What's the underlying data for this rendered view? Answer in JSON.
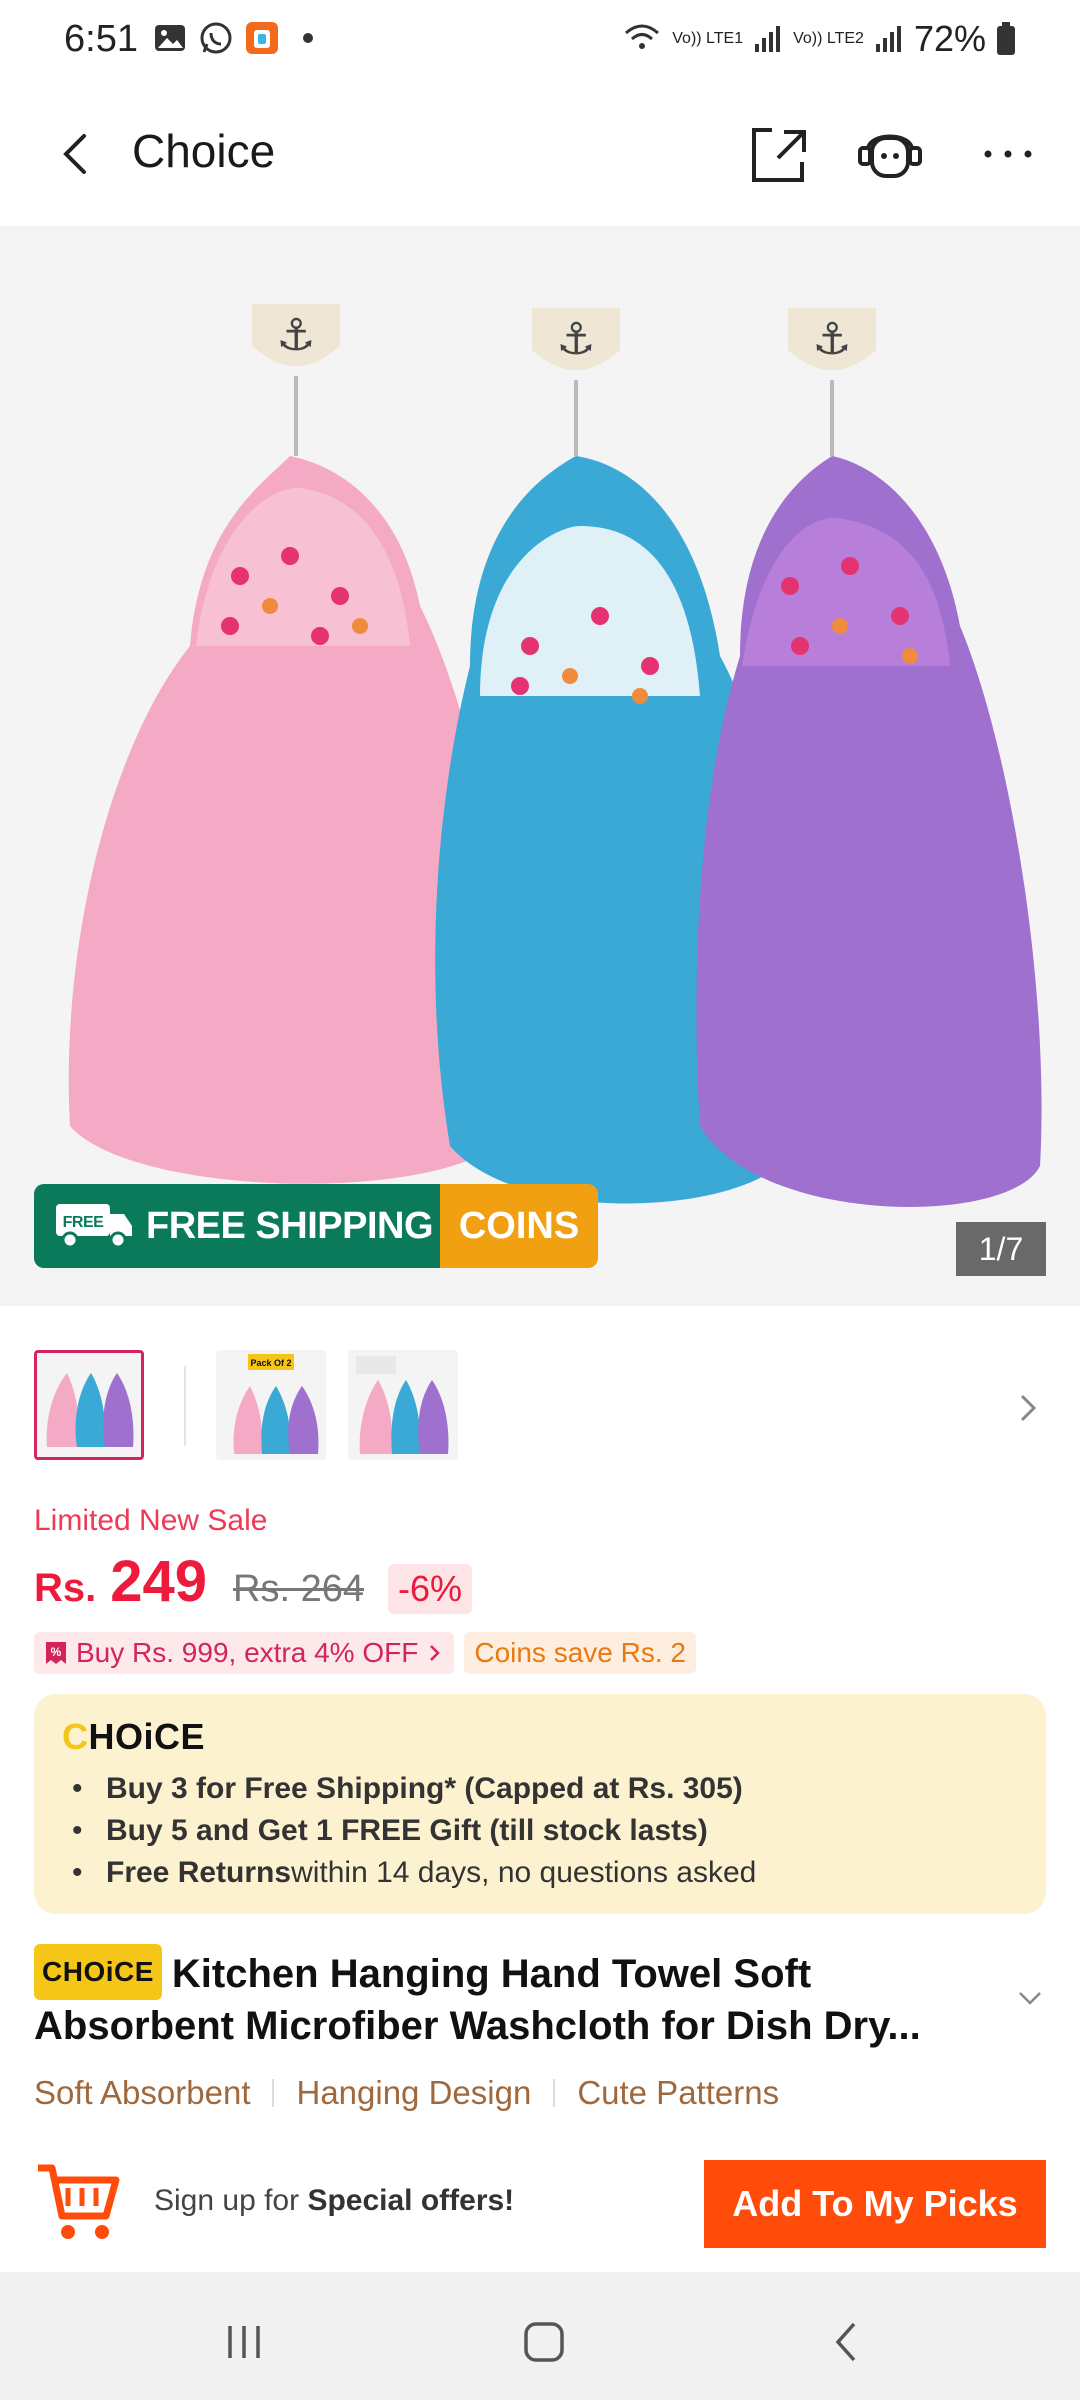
{
  "status_bar": {
    "time": "6:51",
    "battery": "72%",
    "net1": "Vo)) LTE1",
    "net2": "Vo)) LTE2"
  },
  "header": {
    "title": "Choice",
    "icons": [
      "back-icon",
      "share-icon",
      "support-icon",
      "more-icon"
    ]
  },
  "hero": {
    "free_shipping": "FREE SHIPPING",
    "free_tag": "FREE",
    "coins": "COINS",
    "counter": "1/7",
    "towel_colors": [
      "#f4a9c4",
      "#3aa9d6",
      "#a070cf"
    ]
  },
  "thumbnails": {
    "count": 3,
    "pack_badge": "Pack Of 2"
  },
  "price": {
    "label": "Limited New Sale",
    "currency": "Rs.",
    "current": "249",
    "original": "Rs. 264",
    "discount": "-6%"
  },
  "promos": {
    "buy_offer": "Buy Rs. 999, extra 4% OFF",
    "coins_save": "Coins save Rs. 2"
  },
  "choice": {
    "logo_c": "C",
    "logo_rest": "HOiCE",
    "items": [
      {
        "bold": "Buy 3 for  Free Shipping* (Capped at Rs. 305)",
        "rest": ""
      },
      {
        "bold": "Buy 5 and Get 1 FREE Gift (till stock lasts)",
        "rest": ""
      },
      {
        "bold": "Free Returns",
        "rest": " within 14 days, no questions asked"
      }
    ]
  },
  "product": {
    "badge": "CHOiCE",
    "title": "Kitchen Hanging Hand Towel Soft Absorbent Microfiber Washcloth for Dish Dry...",
    "features": [
      "Soft Absorbent",
      "Hanging Design",
      "Cute Patterns"
    ]
  },
  "bottom": {
    "signup_prefix": "Sign up for ",
    "signup_bold": "Special offers!",
    "picks_label": "Add To My Picks"
  },
  "colors": {
    "accent": "#ff4c0a",
    "price_red": "#ee1a3c",
    "choice_bg": "#fdf2d0",
    "ship_green": "#0b7a5a",
    "coins_orange": "#f0a010"
  }
}
